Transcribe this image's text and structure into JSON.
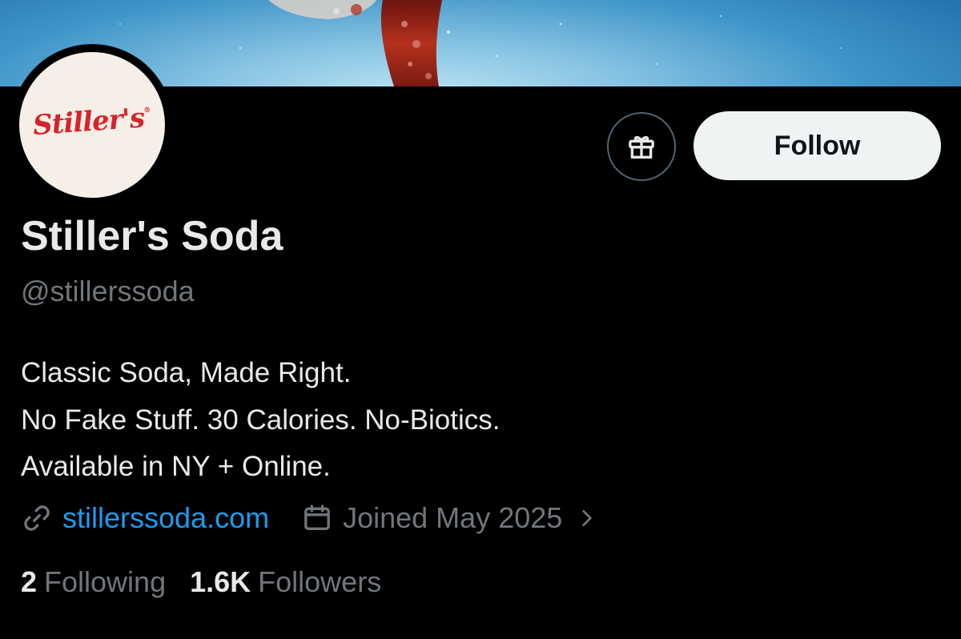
{
  "banner": {
    "description_icon": "soda-splash-banner"
  },
  "avatar": {
    "logo_text": "Stiller's",
    "logo_mark": "®",
    "logo_color": "#d8232a"
  },
  "actions": {
    "gift_icon": "gift-icon",
    "follow_label": "Follow"
  },
  "profile": {
    "display_name": "Stiller's Soda",
    "handle": "@stillerssoda",
    "bio_lines": [
      "Classic Soda, Made Right.",
      "No Fake Stuff. 30 Calories. No-Biotics.",
      "Available in NY + Online."
    ],
    "website": "stillerssoda.com",
    "joined": "Joined May 2025"
  },
  "stats": {
    "following_count": "2",
    "following_label": "Following",
    "followers_count": "1.6K",
    "followers_label": "Followers"
  },
  "colors": {
    "background": "#000000",
    "primary_text": "#e7e9ea",
    "secondary_text": "#71767b",
    "link": "#1d9bf0",
    "follow_bg": "#eff3f4"
  }
}
